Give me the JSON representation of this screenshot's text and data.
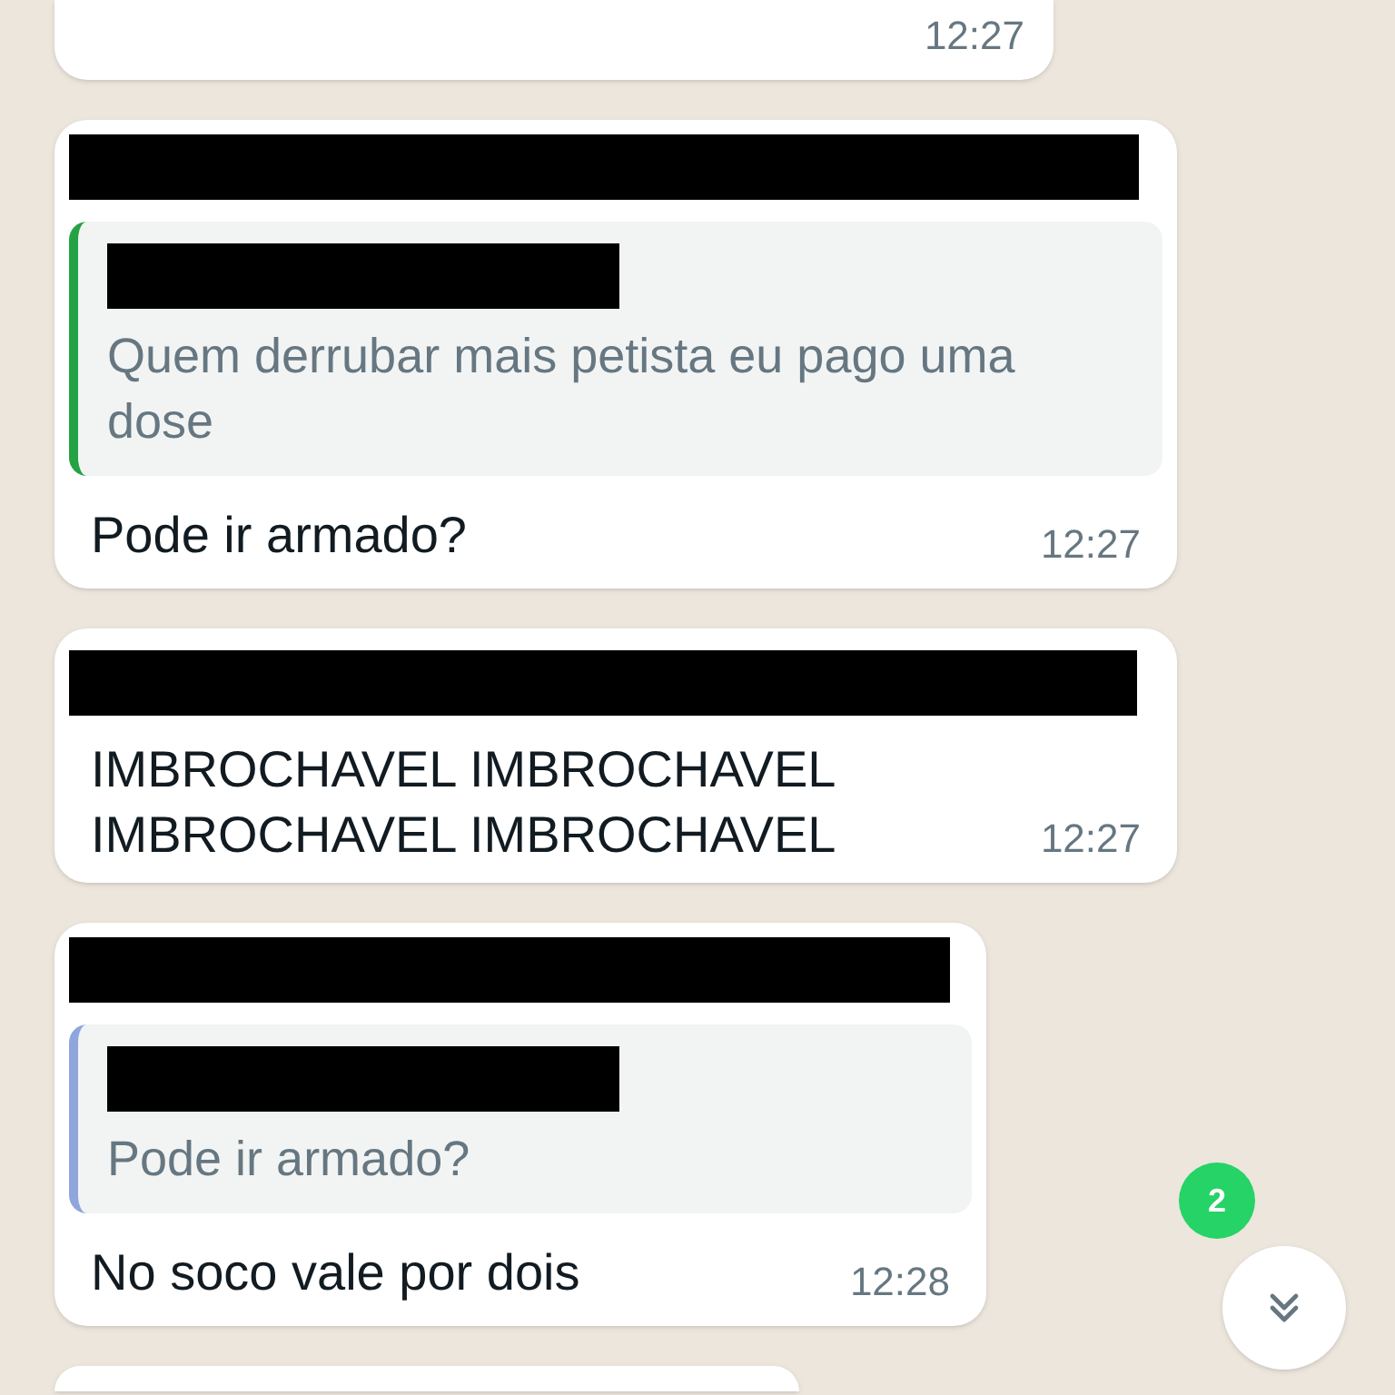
{
  "messages": [
    {
      "kind": "partial_top",
      "time": "12:27"
    },
    {
      "kind": "reply",
      "sender_redacted": true,
      "quote": {
        "author_redacted": true,
        "text": "Quem derrubar mais petista eu pago uma dose",
        "color": "#25a244"
      },
      "text": "Pode ir armado?",
      "time": "12:27"
    },
    {
      "kind": "plain",
      "sender_redacted": true,
      "lines": [
        "IMBROCHAVEL IMBROCHAVEL",
        "IMBROCHAVEL IMBROCHAVEL"
      ],
      "time": "12:27"
    },
    {
      "kind": "reply",
      "sender_redacted": true,
      "quote": {
        "author_redacted": true,
        "text": "Pode ir armado?",
        "color": "#8fa6dd"
      },
      "text": "No soco vale por dois",
      "time": "12:28"
    },
    {
      "kind": "partial_bottom"
    }
  ],
  "unread_badge": "2"
}
